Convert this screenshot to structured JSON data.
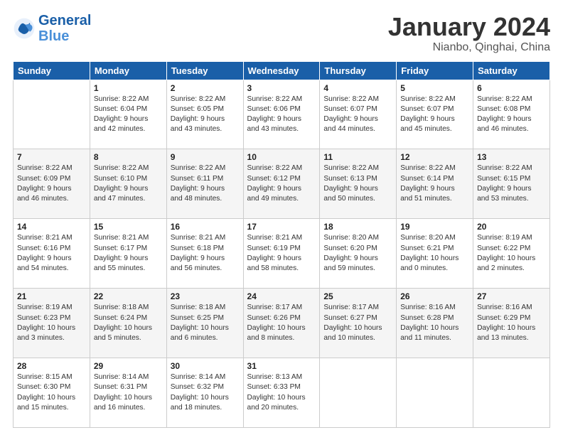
{
  "header": {
    "logo_general": "General",
    "logo_blue": "Blue",
    "title": "January 2024",
    "subtitle": "Nianbo, Qinghai, China"
  },
  "columns": [
    "Sunday",
    "Monday",
    "Tuesday",
    "Wednesday",
    "Thursday",
    "Friday",
    "Saturday"
  ],
  "weeks": [
    [
      {
        "day": "",
        "info": ""
      },
      {
        "day": "1",
        "info": "Sunrise: 8:22 AM\nSunset: 6:04 PM\nDaylight: 9 hours\nand 42 minutes."
      },
      {
        "day": "2",
        "info": "Sunrise: 8:22 AM\nSunset: 6:05 PM\nDaylight: 9 hours\nand 43 minutes."
      },
      {
        "day": "3",
        "info": "Sunrise: 8:22 AM\nSunset: 6:06 PM\nDaylight: 9 hours\nand 43 minutes."
      },
      {
        "day": "4",
        "info": "Sunrise: 8:22 AM\nSunset: 6:07 PM\nDaylight: 9 hours\nand 44 minutes."
      },
      {
        "day": "5",
        "info": "Sunrise: 8:22 AM\nSunset: 6:07 PM\nDaylight: 9 hours\nand 45 minutes."
      },
      {
        "day": "6",
        "info": "Sunrise: 8:22 AM\nSunset: 6:08 PM\nDaylight: 9 hours\nand 46 minutes."
      }
    ],
    [
      {
        "day": "7",
        "info": "Sunrise: 8:22 AM\nSunset: 6:09 PM\nDaylight: 9 hours\nand 46 minutes."
      },
      {
        "day": "8",
        "info": "Sunrise: 8:22 AM\nSunset: 6:10 PM\nDaylight: 9 hours\nand 47 minutes."
      },
      {
        "day": "9",
        "info": "Sunrise: 8:22 AM\nSunset: 6:11 PM\nDaylight: 9 hours\nand 48 minutes."
      },
      {
        "day": "10",
        "info": "Sunrise: 8:22 AM\nSunset: 6:12 PM\nDaylight: 9 hours\nand 49 minutes."
      },
      {
        "day": "11",
        "info": "Sunrise: 8:22 AM\nSunset: 6:13 PM\nDaylight: 9 hours\nand 50 minutes."
      },
      {
        "day": "12",
        "info": "Sunrise: 8:22 AM\nSunset: 6:14 PM\nDaylight: 9 hours\nand 51 minutes."
      },
      {
        "day": "13",
        "info": "Sunrise: 8:22 AM\nSunset: 6:15 PM\nDaylight: 9 hours\nand 53 minutes."
      }
    ],
    [
      {
        "day": "14",
        "info": "Sunrise: 8:21 AM\nSunset: 6:16 PM\nDaylight: 9 hours\nand 54 minutes."
      },
      {
        "day": "15",
        "info": "Sunrise: 8:21 AM\nSunset: 6:17 PM\nDaylight: 9 hours\nand 55 minutes."
      },
      {
        "day": "16",
        "info": "Sunrise: 8:21 AM\nSunset: 6:18 PM\nDaylight: 9 hours\nand 56 minutes."
      },
      {
        "day": "17",
        "info": "Sunrise: 8:21 AM\nSunset: 6:19 PM\nDaylight: 9 hours\nand 58 minutes."
      },
      {
        "day": "18",
        "info": "Sunrise: 8:20 AM\nSunset: 6:20 PM\nDaylight: 9 hours\nand 59 minutes."
      },
      {
        "day": "19",
        "info": "Sunrise: 8:20 AM\nSunset: 6:21 PM\nDaylight: 10 hours\nand 0 minutes."
      },
      {
        "day": "20",
        "info": "Sunrise: 8:19 AM\nSunset: 6:22 PM\nDaylight: 10 hours\nand 2 minutes."
      }
    ],
    [
      {
        "day": "21",
        "info": "Sunrise: 8:19 AM\nSunset: 6:23 PM\nDaylight: 10 hours\nand 3 minutes."
      },
      {
        "day": "22",
        "info": "Sunrise: 8:18 AM\nSunset: 6:24 PM\nDaylight: 10 hours\nand 5 minutes."
      },
      {
        "day": "23",
        "info": "Sunrise: 8:18 AM\nSunset: 6:25 PM\nDaylight: 10 hours\nand 6 minutes."
      },
      {
        "day": "24",
        "info": "Sunrise: 8:17 AM\nSunset: 6:26 PM\nDaylight: 10 hours\nand 8 minutes."
      },
      {
        "day": "25",
        "info": "Sunrise: 8:17 AM\nSunset: 6:27 PM\nDaylight: 10 hours\nand 10 minutes."
      },
      {
        "day": "26",
        "info": "Sunrise: 8:16 AM\nSunset: 6:28 PM\nDaylight: 10 hours\nand 11 minutes."
      },
      {
        "day": "27",
        "info": "Sunrise: 8:16 AM\nSunset: 6:29 PM\nDaylight: 10 hours\nand 13 minutes."
      }
    ],
    [
      {
        "day": "28",
        "info": "Sunrise: 8:15 AM\nSunset: 6:30 PM\nDaylight: 10 hours\nand 15 minutes."
      },
      {
        "day": "29",
        "info": "Sunrise: 8:14 AM\nSunset: 6:31 PM\nDaylight: 10 hours\nand 16 minutes."
      },
      {
        "day": "30",
        "info": "Sunrise: 8:14 AM\nSunset: 6:32 PM\nDaylight: 10 hours\nand 18 minutes."
      },
      {
        "day": "31",
        "info": "Sunrise: 8:13 AM\nSunset: 6:33 PM\nDaylight: 10 hours\nand 20 minutes."
      },
      {
        "day": "",
        "info": ""
      },
      {
        "day": "",
        "info": ""
      },
      {
        "day": "",
        "info": ""
      }
    ]
  ]
}
